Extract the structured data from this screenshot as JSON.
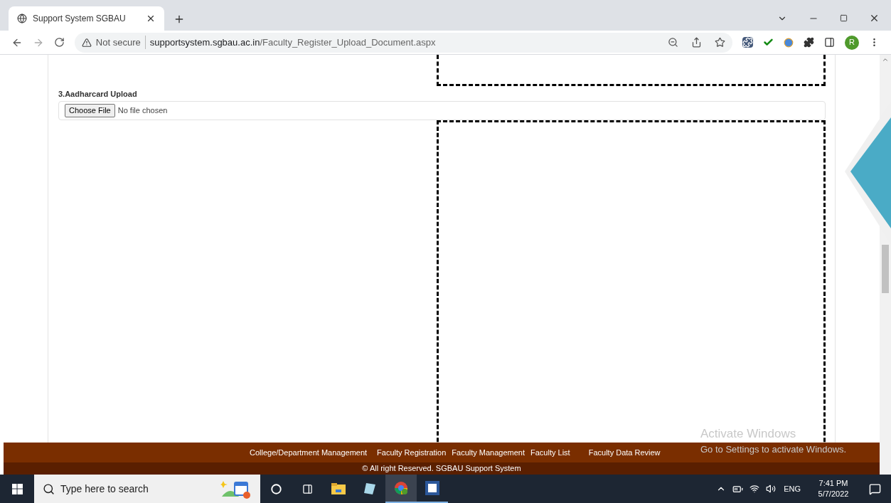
{
  "browser": {
    "tab": {
      "title": "Support System SGBAU"
    },
    "address_bar": {
      "security": "Not secure",
      "url_host": "supportsystem.sgbau.ac.in",
      "url_path": "/Faculty_Register_Upload_Document.aspx"
    },
    "profile": "R"
  },
  "page": {
    "field_label": "3.Aadharcard Upload",
    "file_input": {
      "button": "Choose File",
      "status": "No file chosen"
    }
  },
  "footer": {
    "links": [
      "College/Department Management",
      "Faculty Registration",
      "Faculty Management",
      "Faculty List",
      "Faculty Data Review"
    ],
    "copyright": "© All right Reserved. SGBAU Support System"
  },
  "activation_notice": {
    "title": "Activate Windows",
    "subtitle": "Go to Settings to activate Windows."
  },
  "taskbar": {
    "search_placeholder": "Type here to search",
    "language": "ENG",
    "time": "7:41 PM",
    "date": "5/7/2022"
  }
}
